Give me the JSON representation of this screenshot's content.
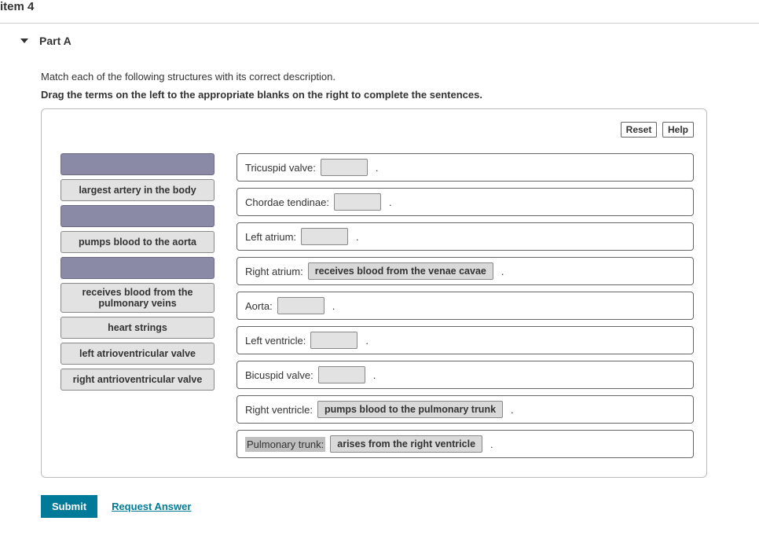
{
  "header": {
    "item_label": "item 4"
  },
  "part": {
    "title": "Part A",
    "prompt": "Match each of the following structures with its correct description.",
    "instruction": "Drag the terms on the left to the appropriate blanks on the right to complete the sentences."
  },
  "buttons": {
    "reset": "Reset",
    "help": "Help",
    "submit": "Submit",
    "request_answer": "Request Answer"
  },
  "terms": [
    {
      "text": "",
      "used": true
    },
    {
      "text": "largest artery in the body",
      "used": false
    },
    {
      "text": "",
      "used": true
    },
    {
      "text": "pumps blood to the aorta",
      "used": false
    },
    {
      "text": "",
      "used": true
    },
    {
      "text": "receives blood from the pulmonary veins",
      "used": false
    },
    {
      "text": "heart strings",
      "used": false
    },
    {
      "text": "left atrioventricular valve",
      "used": false
    },
    {
      "text": "right antrioventricular valve",
      "used": false
    }
  ],
  "sentences": [
    {
      "label": "Tricuspid valve:",
      "value": "",
      "filled": false,
      "selected": false
    },
    {
      "label": "Chordae tendinae:",
      "value": "",
      "filled": false,
      "selected": false
    },
    {
      "label": "Left atrium:",
      "value": "",
      "filled": false,
      "selected": false
    },
    {
      "label": "Right atrium:",
      "value": "receives blood from the venae cavae",
      "filled": true,
      "selected": false
    },
    {
      "label": "Aorta:",
      "value": "",
      "filled": false,
      "selected": false
    },
    {
      "label": "Left ventricle:",
      "value": "",
      "filled": false,
      "selected": false
    },
    {
      "label": "Bicuspid valve:",
      "value": "",
      "filled": false,
      "selected": false
    },
    {
      "label": "Right ventricle:",
      "value": "pumps blood to the pulmonary trunk",
      "filled": true,
      "selected": false
    },
    {
      "label": "Pulmonary trunk:",
      "value": "arises from the right ventricle",
      "filled": true,
      "selected": true
    }
  ]
}
